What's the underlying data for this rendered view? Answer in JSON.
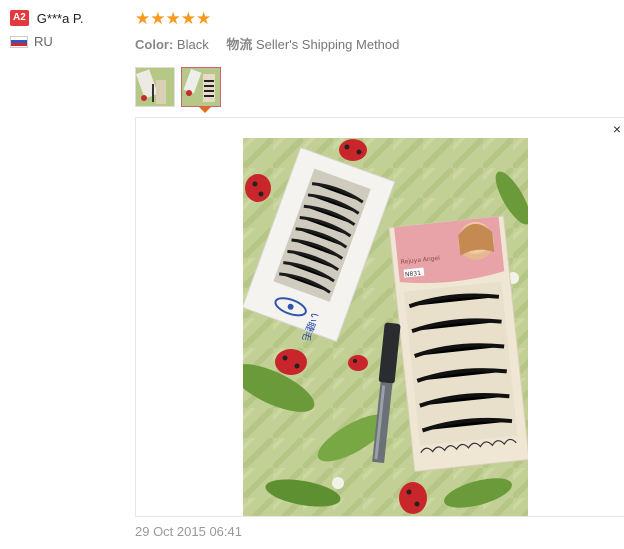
{
  "user": {
    "level_badge": "A2",
    "name": "G***a P.",
    "country": "RU",
    "flag_icon": "russia-flag-icon"
  },
  "review": {
    "rating": 5,
    "rating_max": 5,
    "color_label": "Color:",
    "color_value": "Black",
    "shipping_label": "物流",
    "shipping_value": "Seller's Shipping Method",
    "date": "29 Oct 2015 06:41",
    "star_color": "#f89a1e"
  },
  "gallery": {
    "thumbnails": [
      {
        "name": "thumbnail-1"
      },
      {
        "name": "thumbnail-2",
        "active": true
      }
    ],
    "close_symbol": "×",
    "photo_text": {
      "box_left_blue": "い睫毛",
      "box_right_brand": "Rejuya Angel",
      "box_right_code": "N831"
    }
  }
}
